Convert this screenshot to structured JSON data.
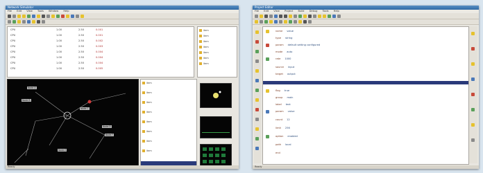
{
  "left_window": {
    "title": "Network Simulator",
    "menu": [
      "File",
      "Edit",
      "View",
      "Tools",
      "Window",
      "Help"
    ],
    "table_rows": [
      {
        "name": "CPU",
        "a": "1.00",
        "b": "2.50",
        "c": "0.001"
      },
      {
        "name": "CPU",
        "a": "1.00",
        "b": "2.50",
        "c": "0.001"
      },
      {
        "name": "CPU",
        "a": "1.00",
        "b": "2.50",
        "c": "0.002"
      },
      {
        "name": "CPU",
        "a": "1.00",
        "b": "2.50",
        "c": "0.003"
      },
      {
        "name": "CPU",
        "a": "1.00",
        "b": "2.50",
        "c": "0.004"
      },
      {
        "name": "CPU",
        "a": "1.00",
        "b": "2.50",
        "c": "0.004"
      },
      {
        "name": "CPU",
        "a": "1.00",
        "b": "2.50",
        "c": "0.004"
      },
      {
        "name": "CPU",
        "a": "1.00",
        "b": "2.50",
        "c": "0.005"
      }
    ],
    "diagram_labels": [
      "Node A",
      "Node B",
      "Node C",
      "Node D",
      "Node E",
      "Node F"
    ],
    "list_items": [
      "item",
      "item",
      "item",
      "item",
      "item",
      "item",
      "item",
      "item",
      "item",
      "item",
      "item",
      "item",
      "item",
      "item",
      "item"
    ],
    "status": "Ready"
  },
  "right_window": {
    "title": "Project Editor",
    "menu": [
      "File",
      "Edit",
      "View",
      "Project",
      "Build",
      "Debug",
      "Tools",
      "Help"
    ],
    "rows": [
      {
        "k": "name",
        "v": "value"
      },
      {
        "k": "type",
        "v": "string"
      },
      {
        "k": "param",
        "v": "default setting configured"
      },
      {
        "k": "mode",
        "v": "auto"
      },
      {
        "k": "rate",
        "v": "1000"
      },
      {
        "k": "source",
        "v": "input"
      },
      {
        "k": "target",
        "v": "output"
      },
      {
        "k": "flag",
        "v": "true"
      },
      {
        "k": "group",
        "v": "main"
      },
      {
        "k": "label",
        "v": "text"
      },
      {
        "k": "param",
        "v": "value"
      },
      {
        "k": "count",
        "v": "12"
      },
      {
        "k": "limit",
        "v": "256"
      },
      {
        "k": "option",
        "v": "enabled"
      },
      {
        "k": "path",
        "v": "local"
      },
      {
        "k": "end",
        "v": ""
      }
    ],
    "status": "Ready"
  }
}
